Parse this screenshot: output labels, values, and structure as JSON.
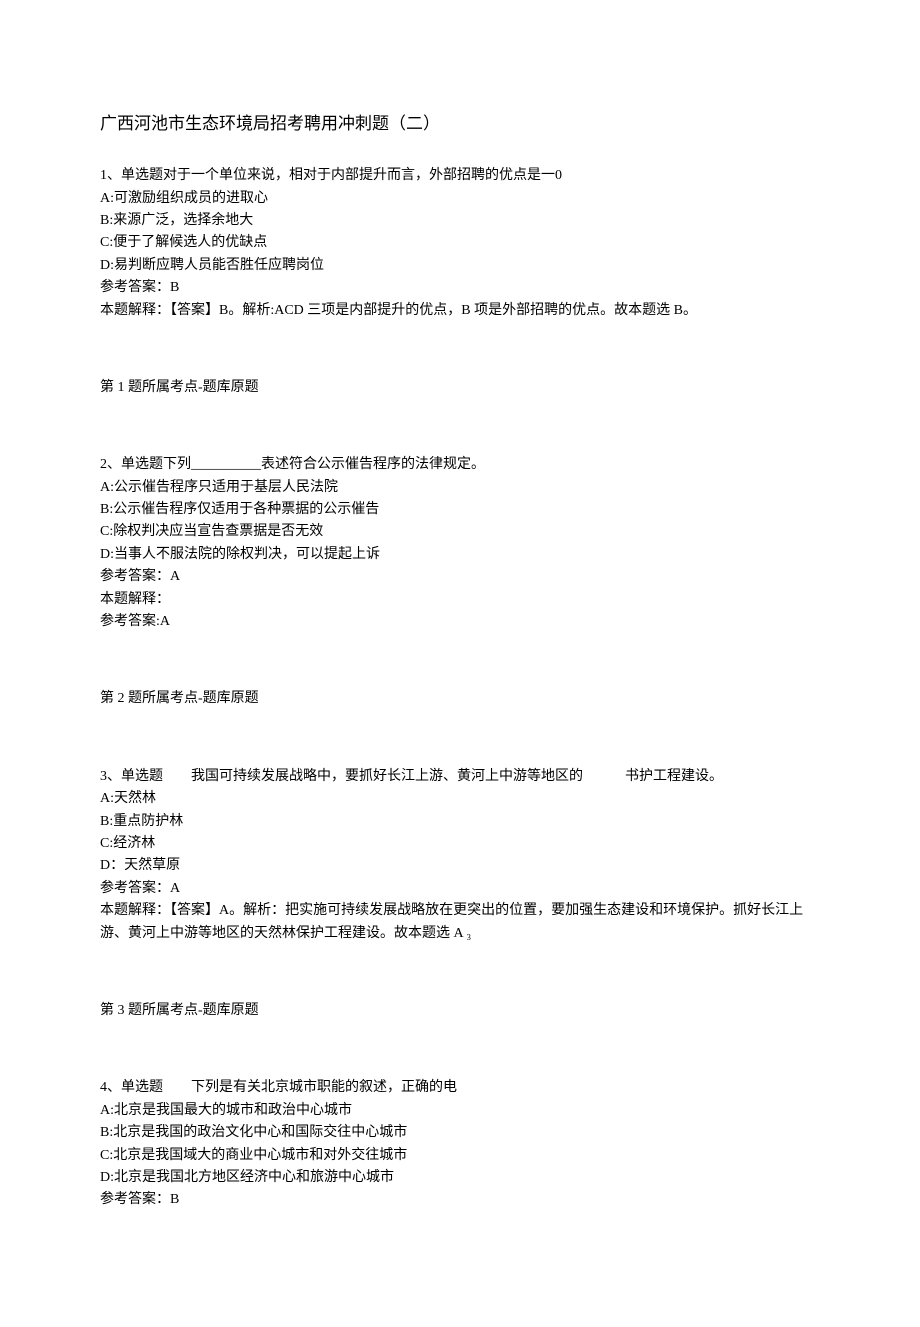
{
  "title": "广西河池市生态环境局招考聘用冲刺题（二）",
  "questions": [
    {
      "stem": "1、单选题对于一个单位来说，相对于内部提升而言，外部招聘的优点是一0",
      "opts": [
        "A:可激励组织成员的进取心",
        "B:来源广泛，选择余地大",
        "C:便于了解候选人的优缺点",
        "D:易判断应聘人员能否胜任应聘岗位"
      ],
      "ans": "参考答案：B",
      "exp": "本题解释：【答案】B。解析:ACD 三项是内部提升的优点，B 项是外部招聘的优点。故本题选 B。",
      "topic": "第 1 题所属考点-题库原题"
    },
    {
      "stem": "2、单选题下列__________表述符合公示催告程序的法律规定。",
      "opts": [
        "A:公示催告程序只适用于基层人民法院",
        "B:公示催告程序仅适用于各种票据的公示催告",
        "C:除权判决应当宣告查票据是否无效",
        "D:当事人不服法院的除权判决，可以提起上诉"
      ],
      "ans": "参考答案：A",
      "exp": "本题解释：",
      "extra": "参考答案:A",
      "topic": "第 2 题所属考点-题库原题"
    },
    {
      "stem": "3、单选题　　我国可持续发展战略中，要抓好长江上游、黄河上中游等地区的　　　书护工程建设。",
      "opts": [
        "A:天然林",
        "B:重点防护林",
        "C:经济林",
        "D：天然草原"
      ],
      "ans": "参考答案：A",
      "exp": "本题解释：【答案】A。解析：把实施可持续发展战略放在更突出的位置，要加强生态建设和环境保护。抓好长江上游、黄河上中游等地区的天然林保护工程建设。故本题选 A ₃",
      "topic": "第 3 题所属考点-题库原题"
    },
    {
      "stem": "4、单选题　　下列是有关北京城市职能的叙述，正确的电",
      "opts": [
        "A:北京是我国最大的城市和政治中心城市",
        "B:北京是我国的政治文化中心和国际交往中心城市",
        "C:北京是我国域大的商业中心城市和对外交往城市",
        "D:北京是我国北方地区经济中心和旅游中心城市"
      ],
      "ans": "参考答案：B",
      "topic": ""
    }
  ]
}
